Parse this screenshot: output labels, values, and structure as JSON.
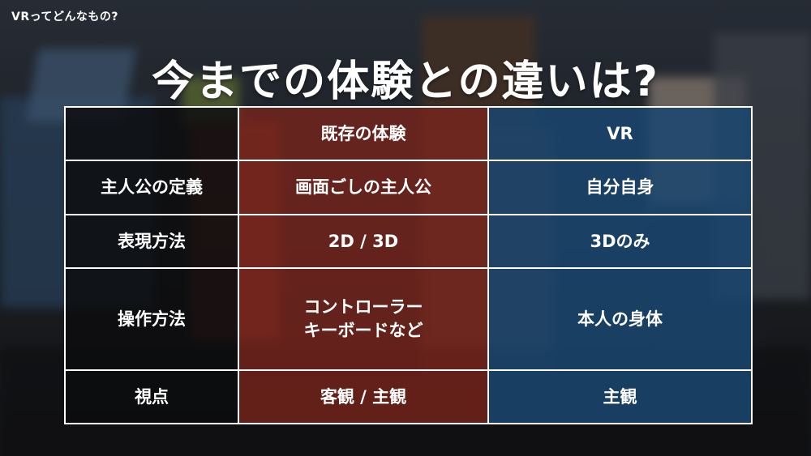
{
  "breadcrumb": "VRってどんなもの?",
  "title": "今までの体験との違いは?",
  "table": {
    "headers": [
      "",
      "既存の体験",
      "VR"
    ],
    "rows": [
      {
        "label": "主人公の定義",
        "old": [
          "画面ごしの主人公"
        ],
        "vr": "自分自身"
      },
      {
        "label": "表現方法",
        "old": [
          "2D / 3D"
        ],
        "vr": "3Dのみ"
      },
      {
        "label": "操作方法",
        "old": [
          "コントローラー",
          "キーボードなど"
        ],
        "vr": "本人の身体"
      },
      {
        "label": "視点",
        "old": [
          "客観 / 主観"
        ],
        "vr": "主観"
      }
    ]
  },
  "colors": {
    "label_col": "#0c0c0e",
    "old_col": "#78241c",
    "vr_col": "#1a4670",
    "border": "#ffffff"
  }
}
